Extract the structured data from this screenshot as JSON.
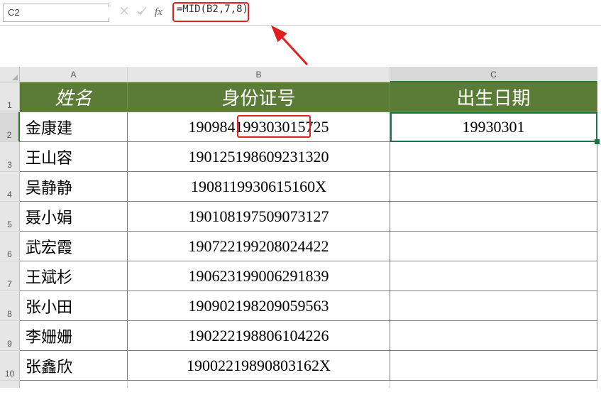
{
  "formulaBar": {
    "nameBox": "C2",
    "formula": "=MID(B2,7,8)"
  },
  "columns": {
    "A": "A",
    "B": "B",
    "C": "C"
  },
  "rowNumbers": [
    "1",
    "2",
    "3",
    "4",
    "5",
    "6",
    "7",
    "8",
    "9",
    "10"
  ],
  "headers": {
    "A": "姓名",
    "B": "身份证号",
    "C": "出生日期"
  },
  "rows": [
    {
      "name": "金康建",
      "id": "190984199303015725",
      "dob": "19930301"
    },
    {
      "name": "王山容",
      "id": "190125198609231320",
      "dob": ""
    },
    {
      "name": "吴静静",
      "id": "19081199306151­60X",
      "dob": ""
    },
    {
      "name": "聂小娟",
      "id": "190108197509073127",
      "dob": ""
    },
    {
      "name": "武宏霞",
      "id": "190722199208024422",
      "dob": ""
    },
    {
      "name": "王斌杉",
      "id": "190623199006291839",
      "dob": ""
    },
    {
      "name": "张小田",
      "id": "190902198209059563",
      "dob": ""
    },
    {
      "name": "李姗姗",
      "id": "190222198806104226",
      "dob": ""
    },
    {
      "name": "张鑫欣",
      "id": "19002219890803162X",
      "dob": ""
    }
  ],
  "selectedCell": "C2"
}
